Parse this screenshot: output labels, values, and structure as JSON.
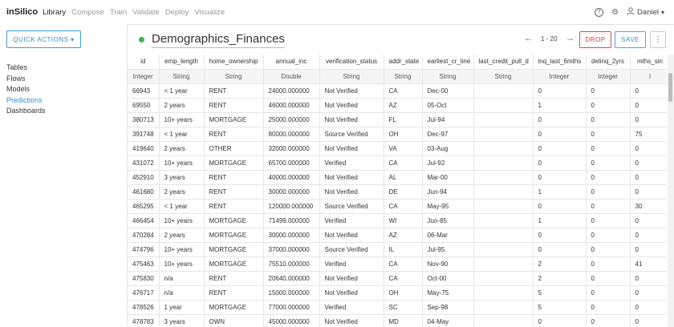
{
  "nav": {
    "brand": "inSilico",
    "items": [
      {
        "label": "Library",
        "active": true
      },
      {
        "label": "Compose",
        "active": false
      },
      {
        "label": "Train",
        "active": false
      },
      {
        "label": "Validate",
        "active": false
      },
      {
        "label": "Deploy",
        "active": false
      },
      {
        "label": "Visualize",
        "active": false
      }
    ],
    "help_icon": "?",
    "settings_icon": "⚙",
    "user_icon": "👤",
    "user_name": "Daniel",
    "user_caret": "▾"
  },
  "sidebar": {
    "quick_actions": "QUICK ACTIONS ▾",
    "items": [
      {
        "label": "Tables",
        "active": false
      },
      {
        "label": "Flows",
        "active": false
      },
      {
        "label": "Models",
        "active": false
      },
      {
        "label": "Predictions",
        "active": true
      },
      {
        "label": "Dashboards",
        "active": false
      }
    ]
  },
  "header": {
    "status_color": "#3cb54a",
    "title": "Demographics_Finances",
    "prev_icon": "←",
    "range": "1 - 20",
    "next_icon": "→",
    "drop_label": "DROP",
    "save_label": "SAVE",
    "more_icon": "⋮"
  },
  "table": {
    "columns": [
      {
        "name": "id",
        "type": "Integer"
      },
      {
        "name": "emp_length",
        "type": "String"
      },
      {
        "name": "home_ownership",
        "type": "String"
      },
      {
        "name": "annual_inc",
        "type": "Double"
      },
      {
        "name": "verification_status",
        "type": "String"
      },
      {
        "name": "addr_state",
        "type": "String"
      },
      {
        "name": "earliest_cr_line",
        "type": "String"
      },
      {
        "name": "last_credit_pull_d",
        "type": "String"
      },
      {
        "name": "inq_last_6mths",
        "type": "Integer"
      },
      {
        "name": "delinq_2yrs",
        "type": "Integer"
      },
      {
        "name": "mths_sin",
        "type": "I"
      }
    ],
    "rows": [
      [
        "66943",
        "< 1 year",
        "RENT",
        "24000.000000",
        "Not Verified",
        "CA",
        "Dec-00",
        "",
        "0",
        "0",
        "0"
      ],
      [
        "69550",
        "2 years",
        "RENT",
        "46000.000000",
        "Not Verified",
        "AZ",
        "05-Oct",
        "",
        "1",
        "0",
        "0"
      ],
      [
        "380713",
        "10+ years",
        "MORTGAGE",
        "25000.000000",
        "Not Verified",
        "FL",
        "Jul-94",
        "",
        "0",
        "0",
        "0"
      ],
      [
        "391748",
        "< 1 year",
        "RENT",
        "80000.000000",
        "Source Verified",
        "OH",
        "Dec-97",
        "",
        "0",
        "0",
        "75"
      ],
      [
        "419640",
        "2 years",
        "OTHER",
        "32000.000000",
        "Not Verified",
        "VA",
        "03-Aug",
        "",
        "0",
        "0",
        "0"
      ],
      [
        "431072",
        "10+ years",
        "MORTGAGE",
        "65700.000000",
        "Verified",
        "CA",
        "Jul-92",
        "",
        "0",
        "0",
        "0"
      ],
      [
        "452910",
        "3 years",
        "RENT",
        "40000.000000",
        "Not Verified",
        "AL",
        "Mar-00",
        "",
        "0",
        "0",
        "0"
      ],
      [
        "461680",
        "2 years",
        "RENT",
        "30000.000000",
        "Not Verified",
        "DE",
        "Jun-94",
        "",
        "1",
        "0",
        "0"
      ],
      [
        "465295",
        "< 1 year",
        "RENT",
        "120000.000000",
        "Source Verified",
        "CA",
        "May-95",
        "",
        "0",
        "0",
        "30"
      ],
      [
        "466454",
        "10+ years",
        "MORTGAGE",
        "71499.000000",
        "Verified",
        "WI",
        "Jun-85",
        "",
        "1",
        "0",
        "0"
      ],
      [
        "470284",
        "2 years",
        "MORTGAGE",
        "30000.000000",
        "Not Verified",
        "AZ",
        "06-Mar",
        "",
        "0",
        "0",
        "0"
      ],
      [
        "474796",
        "10+ years",
        "MORTGAGE",
        "37000.000000",
        "Source Verified",
        "IL",
        "Jul-95",
        "",
        "0",
        "0",
        "0"
      ],
      [
        "475463",
        "10+ years",
        "MORTGAGE",
        "75510.000000",
        "Verified",
        "CA",
        "Nov-90",
        "",
        "2",
        "0",
        "41"
      ],
      [
        "475830",
        "n/a",
        "RENT",
        "20640.000000",
        "Not Verified",
        "CA",
        "Oct-00",
        "",
        "2",
        "0",
        "0"
      ],
      [
        "476717",
        "n/a",
        "RENT",
        "15000.000000",
        "Not Verified",
        "OH",
        "May-75",
        "",
        "5",
        "0",
        "0"
      ],
      [
        "478526",
        "1 year",
        "MORTGAGE",
        "77000.000000",
        "Verified",
        "SC",
        "Sep-98",
        "",
        "5",
        "0",
        "0"
      ],
      [
        "478783",
        "3 years",
        "OWN",
        "45000.000000",
        "Not Verified",
        "MD",
        "04-May",
        "",
        "0",
        "0",
        "0"
      ]
    ]
  }
}
